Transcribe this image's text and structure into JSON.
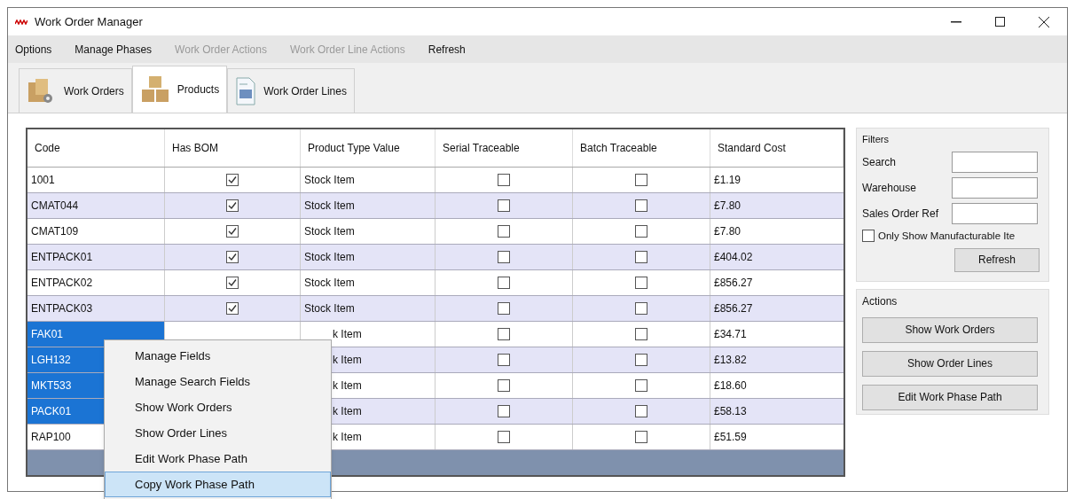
{
  "window": {
    "title": "Work Order Manager"
  },
  "menu": [
    {
      "label": "Options",
      "disabled": false
    },
    {
      "label": "Manage Phases",
      "disabled": false
    },
    {
      "label": "Work Order Actions",
      "disabled": true
    },
    {
      "label": "Work Order Line Actions",
      "disabled": true
    },
    {
      "label": "Refresh",
      "disabled": false
    }
  ],
  "tabs": [
    {
      "label": "Work Orders",
      "selected": false,
      "kind": "orders"
    },
    {
      "label": "Products",
      "selected": true,
      "kind": "products"
    },
    {
      "label": "Work Order Lines",
      "selected": false,
      "kind": "lines"
    }
  ],
  "table": {
    "columns": [
      "Code",
      "Has BOM",
      "Product Type Value",
      "Serial Traceable",
      "Batch Traceable",
      "Standard Cost"
    ],
    "rows": [
      {
        "code": "1001",
        "has_bom": true,
        "product_type": "Stock Item",
        "serial": false,
        "batch": false,
        "cost": "£1.19",
        "selected": false
      },
      {
        "code": "CMAT044",
        "has_bom": true,
        "product_type": "Stock Item",
        "serial": false,
        "batch": false,
        "cost": "£7.80",
        "selected": false
      },
      {
        "code": "CMAT109",
        "has_bom": true,
        "product_type": "Stock Item",
        "serial": false,
        "batch": false,
        "cost": "£7.80",
        "selected": false
      },
      {
        "code": "ENTPACK01",
        "has_bom": true,
        "product_type": "Stock Item",
        "serial": false,
        "batch": false,
        "cost": "£404.02",
        "selected": false
      },
      {
        "code": "ENTPACK02",
        "has_bom": true,
        "product_type": "Stock Item",
        "serial": false,
        "batch": false,
        "cost": "£856.27",
        "selected": false
      },
      {
        "code": "ENTPACK03",
        "has_bom": true,
        "product_type": "Stock Item",
        "serial": false,
        "batch": false,
        "cost": "£856.27",
        "selected": false
      },
      {
        "code": "FAK01",
        "product_type": "k Item",
        "serial": false,
        "batch": false,
        "cost": "£34.71",
        "selected": true
      },
      {
        "code": "LGH132",
        "product_type": "k Item",
        "serial": false,
        "batch": false,
        "cost": "£13.82",
        "selected": true
      },
      {
        "code": "MKT533",
        "product_type": "k Item",
        "serial": false,
        "batch": false,
        "cost": "£18.60",
        "selected": true
      },
      {
        "code": "PACK01",
        "product_type": "k Item",
        "serial": false,
        "batch": false,
        "cost": "£58.13",
        "selected": true
      },
      {
        "code": "RAP100",
        "product_type": "k Item",
        "serial": false,
        "batch": false,
        "cost": "£51.59",
        "selected": false
      }
    ]
  },
  "filters": {
    "title": "Filters",
    "fields": [
      {
        "label": "Search"
      },
      {
        "label": "Warehouse"
      },
      {
        "label": "Sales Order Ref"
      }
    ],
    "only_manufacturable": {
      "label": "Only Show Manufacturable Ite",
      "checked": false
    },
    "refresh_button": "Refresh"
  },
  "actions": {
    "title": "Actions",
    "buttons": [
      "Show Work Orders",
      "Show Order Lines",
      "Edit Work Phase Path"
    ]
  },
  "context_menu": [
    {
      "label": "Manage Fields",
      "selected": false
    },
    {
      "label": "Manage Search Fields",
      "selected": false
    },
    {
      "label": "Show Work Orders",
      "selected": false
    },
    {
      "label": "Show Order Lines",
      "selected": false
    },
    {
      "label": "Edit Work Phase Path",
      "selected": false
    },
    {
      "label": "Copy Work Phase Path",
      "selected": true
    }
  ]
}
